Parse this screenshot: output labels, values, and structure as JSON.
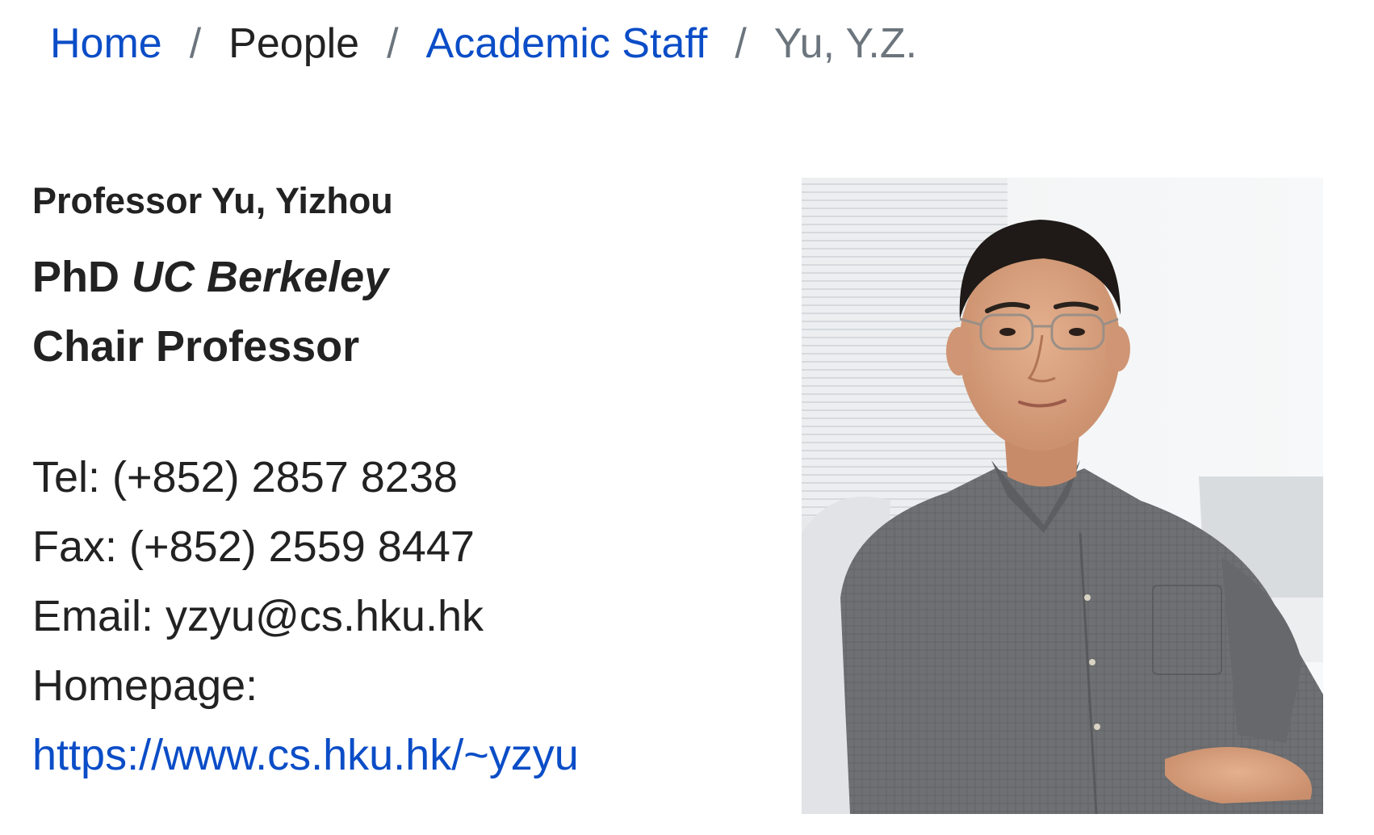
{
  "breadcrumb": {
    "home": "Home",
    "separator": "/",
    "people": "People",
    "academic_staff": "Academic Staff",
    "current": "Yu, Y.Z."
  },
  "profile": {
    "name": "Professor Yu, Yizhou",
    "degree": "PhD",
    "institution": "UC Berkeley",
    "position": "Chair Professor"
  },
  "contact": {
    "tel": "Tel: (+852) 2857 8238",
    "fax": "Fax: (+852) 2559 8447",
    "email": "Email: yzyu@cs.hku.hk",
    "homepage_label": "Homepage:",
    "homepage_url": "https://www.cs.hku.hk/~yzyu"
  },
  "colors": {
    "link": "#0b4dc7",
    "text": "#222222",
    "muted": "#6c757d"
  }
}
